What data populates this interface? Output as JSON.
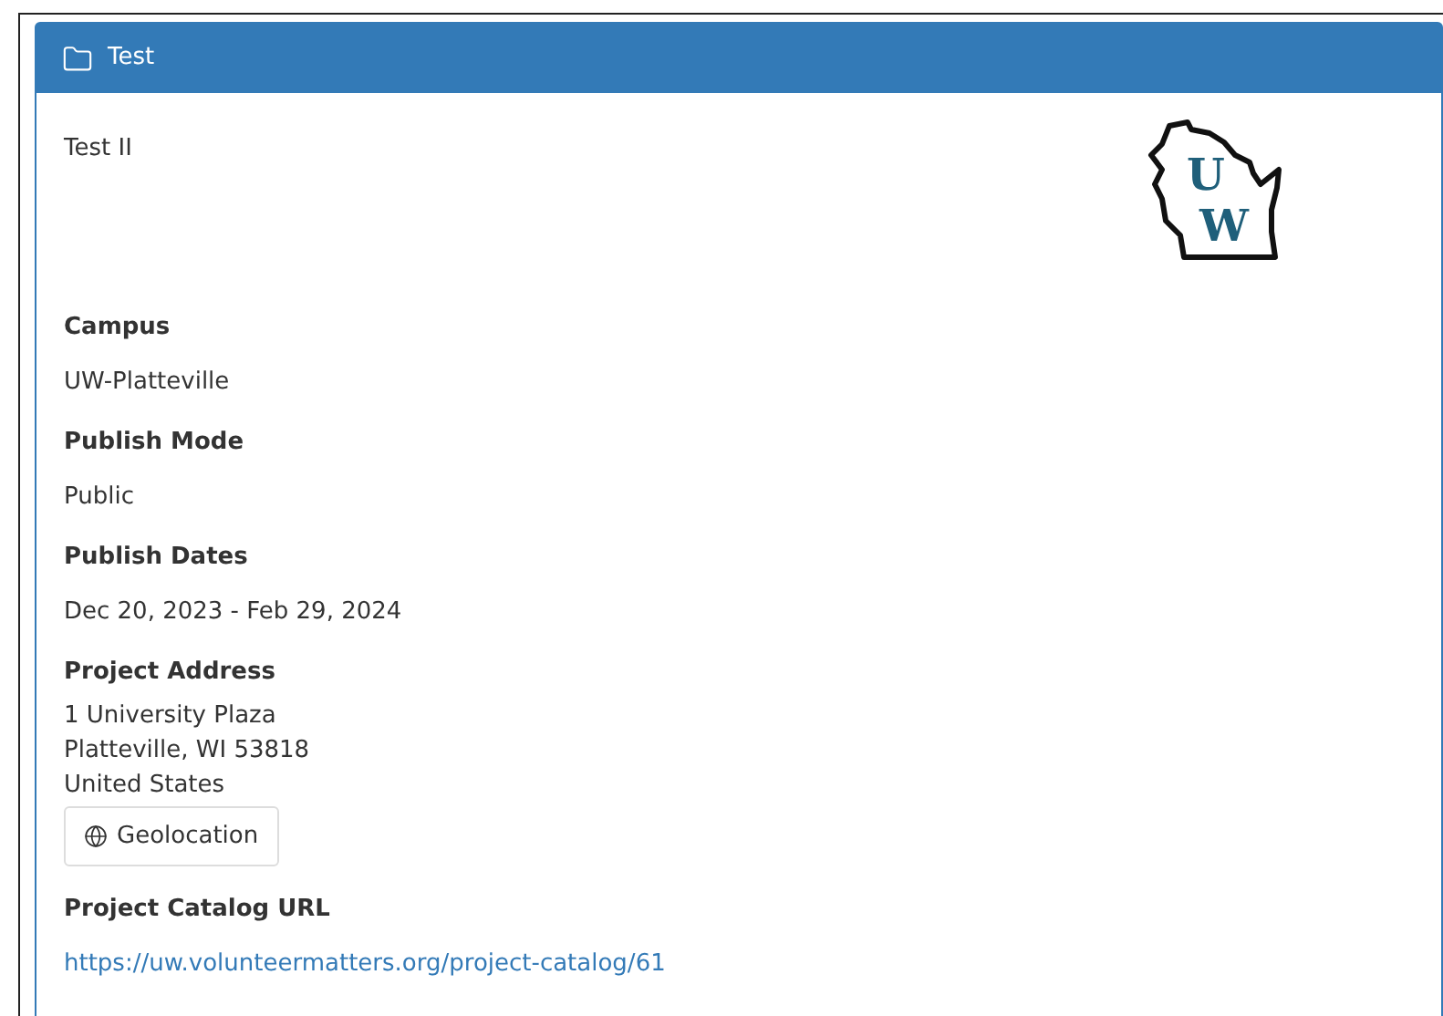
{
  "panel": {
    "title": "Test"
  },
  "description": "Test II",
  "logo": {
    "letters": [
      "U",
      "W"
    ]
  },
  "fields": [
    {
      "kind": "text",
      "label": "Campus",
      "lines": [
        "UW-Platteville"
      ]
    },
    {
      "kind": "text",
      "label": "Publish Mode",
      "lines": [
        "Public"
      ]
    },
    {
      "kind": "text",
      "label": "Publish Dates",
      "lines": [
        "Dec 20, 2023 - Feb 29, 2024"
      ]
    },
    {
      "kind": "address",
      "label": "Project Address",
      "lines": [
        "1 University Plaza",
        "Platteville, WI 53818",
        "United States"
      ],
      "button": "Geolocation"
    },
    {
      "kind": "link",
      "label": "Project Catalog URL",
      "lines": [
        "https://uw.volunteermatters.org/project-catalog/61"
      ]
    }
  ]
}
